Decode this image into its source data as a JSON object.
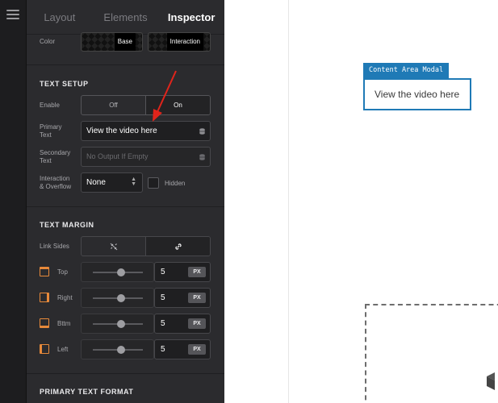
{
  "tabs": [
    {
      "label": "Layout"
    },
    {
      "label": "Elements"
    },
    {
      "label": "Inspector"
    }
  ],
  "color": {
    "label": "Color",
    "base": "Base",
    "interaction": "Interaction"
  },
  "text_setup": {
    "title": "TEXT SETUP",
    "enable_label": "Enable",
    "off": "Off",
    "on": "On",
    "primary_label_1": "Primary",
    "primary_label_2": "Text",
    "primary_value": "View the video here",
    "secondary_label_1": "Secondary",
    "secondary_label_2": "Text",
    "secondary_placeholder": "No Output If Empty",
    "overflow_label_1": "Interaction",
    "overflow_label_2": "& Overflow",
    "overflow_value": "None",
    "hidden_label": "Hidden"
  },
  "text_margin": {
    "title": "TEXT MARGIN",
    "link_sides_label": "Link Sides",
    "sides": [
      {
        "label": "Top",
        "value": "5",
        "unit": "PX"
      },
      {
        "label": "Right",
        "value": "5",
        "unit": "PX"
      },
      {
        "label": "Bttm",
        "value": "5",
        "unit": "PX"
      },
      {
        "label": "Left",
        "value": "5",
        "unit": "PX"
      }
    ]
  },
  "primary_text_format": {
    "title": "PRIMARY TEXT FORMAT"
  },
  "canvas": {
    "modal_tag": "Content Area Modal",
    "modal_text": "View the video here"
  },
  "colors": {
    "accent_blue": "#1f7ab6",
    "margin_icon_orange": "#e7893a",
    "annotation_red": "#e0241b"
  }
}
